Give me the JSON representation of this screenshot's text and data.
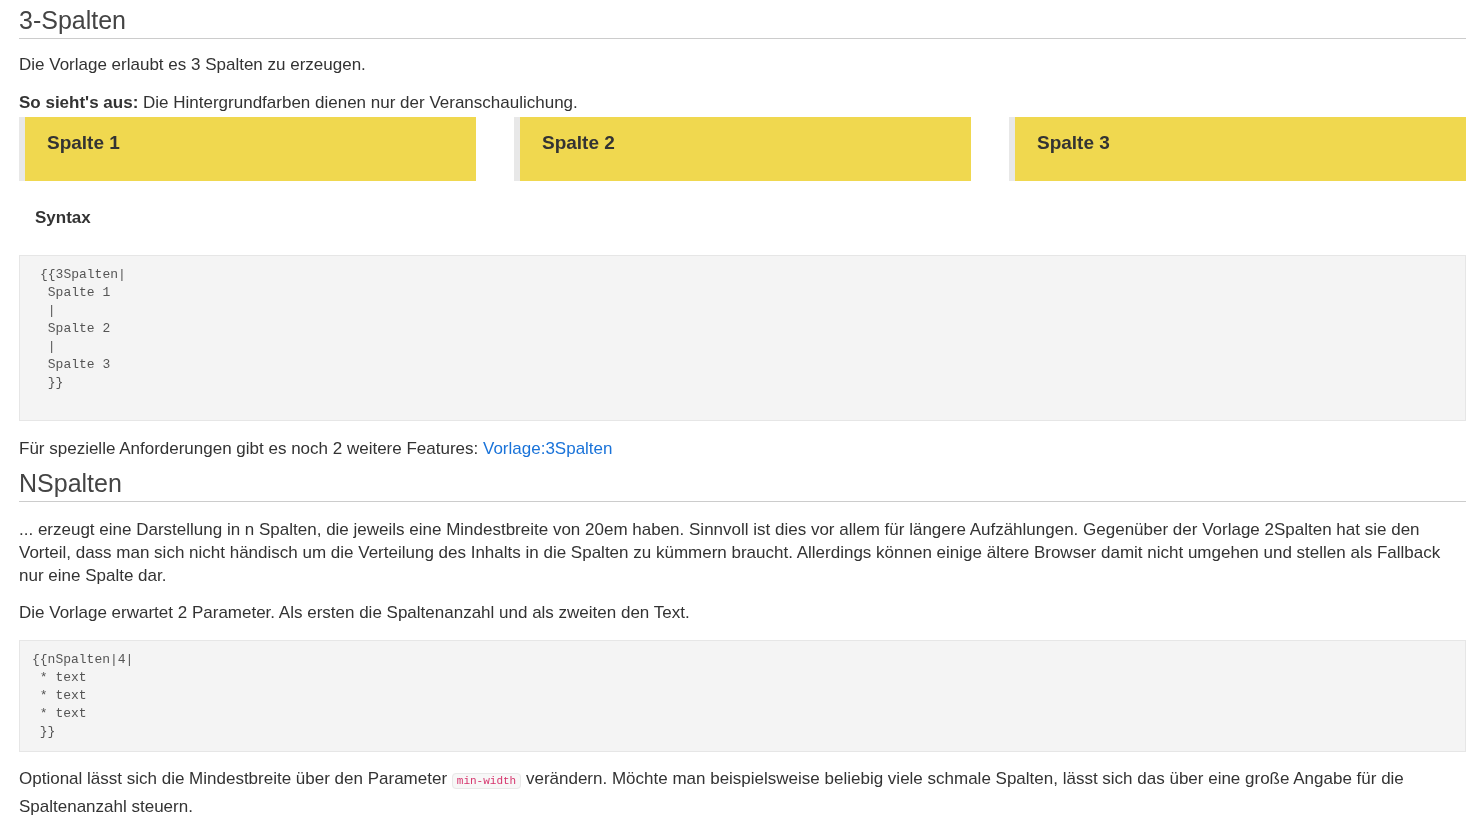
{
  "sections": [
    {
      "heading": "3-Spalten",
      "intro": "Die Vorlage erlaubt es 3 Spalten zu erzeugen.",
      "example_caption": "**So sieht's aus:** Die Hintergrundfarben dienen nur der Veranschaulichung.",
      "columns": [
        {
          "label": "Spalte 1",
          "color": "#f0d84f"
        },
        {
          "label": "Spalte 2",
          "color": "#f0d84f"
        },
        {
          "label": "Spalte 3",
          "color": "#f0d84f"
        }
      ],
      "syntax_heading": "Syntax",
      "code": [
        "{{3Spalten|",
        " Spalte 1",
        " |",
        " Spalte 2",
        " |",
        " Spalte 3",
        " }}"
      ],
      "note": {
        "text": "Für spezielle Anforderungen gibt es noch 2 weitere Features:",
        "link": "Vorlage:3Spalten"
      }
    },
    {
      "heading": "NSpalten",
      "paragraphs": [
        "... erzeugt eine Darstellung in n Spalten, die jeweils eine Mindestbreite von 20em haben. Sinnvoll ist dies vor allem für längere Aufzählungen. Gegenüber der Vorlage 2Spalten hat sie den Vorteil, dass man sich nicht händisch um die Verteilung des Inhalts in die Spalten zu kümmern braucht. Allerdings können einige ältere Browser damit nicht umgehen und stellen als Fallback nur eine Spalte dar.",
        "Die Vorlage erwartet 2 Parameter. Als ersten die Spaltenanzahl und als zweiten den Text."
      ],
      "code": [
        "{{nSpalten|4|",
        " * text",
        " * text",
        " * text",
        " }}"
      ],
      "final": {
        "before": "Optional lässt sich die Mindestbreite über den Parameter",
        "code": "min-width",
        "after": "verändern. Möchte man beispielsweise beliebig viele schmale Spalten, lässt sich das über eine große Angabe für die Spaltenanzahl steuern."
      }
    }
  ]
}
